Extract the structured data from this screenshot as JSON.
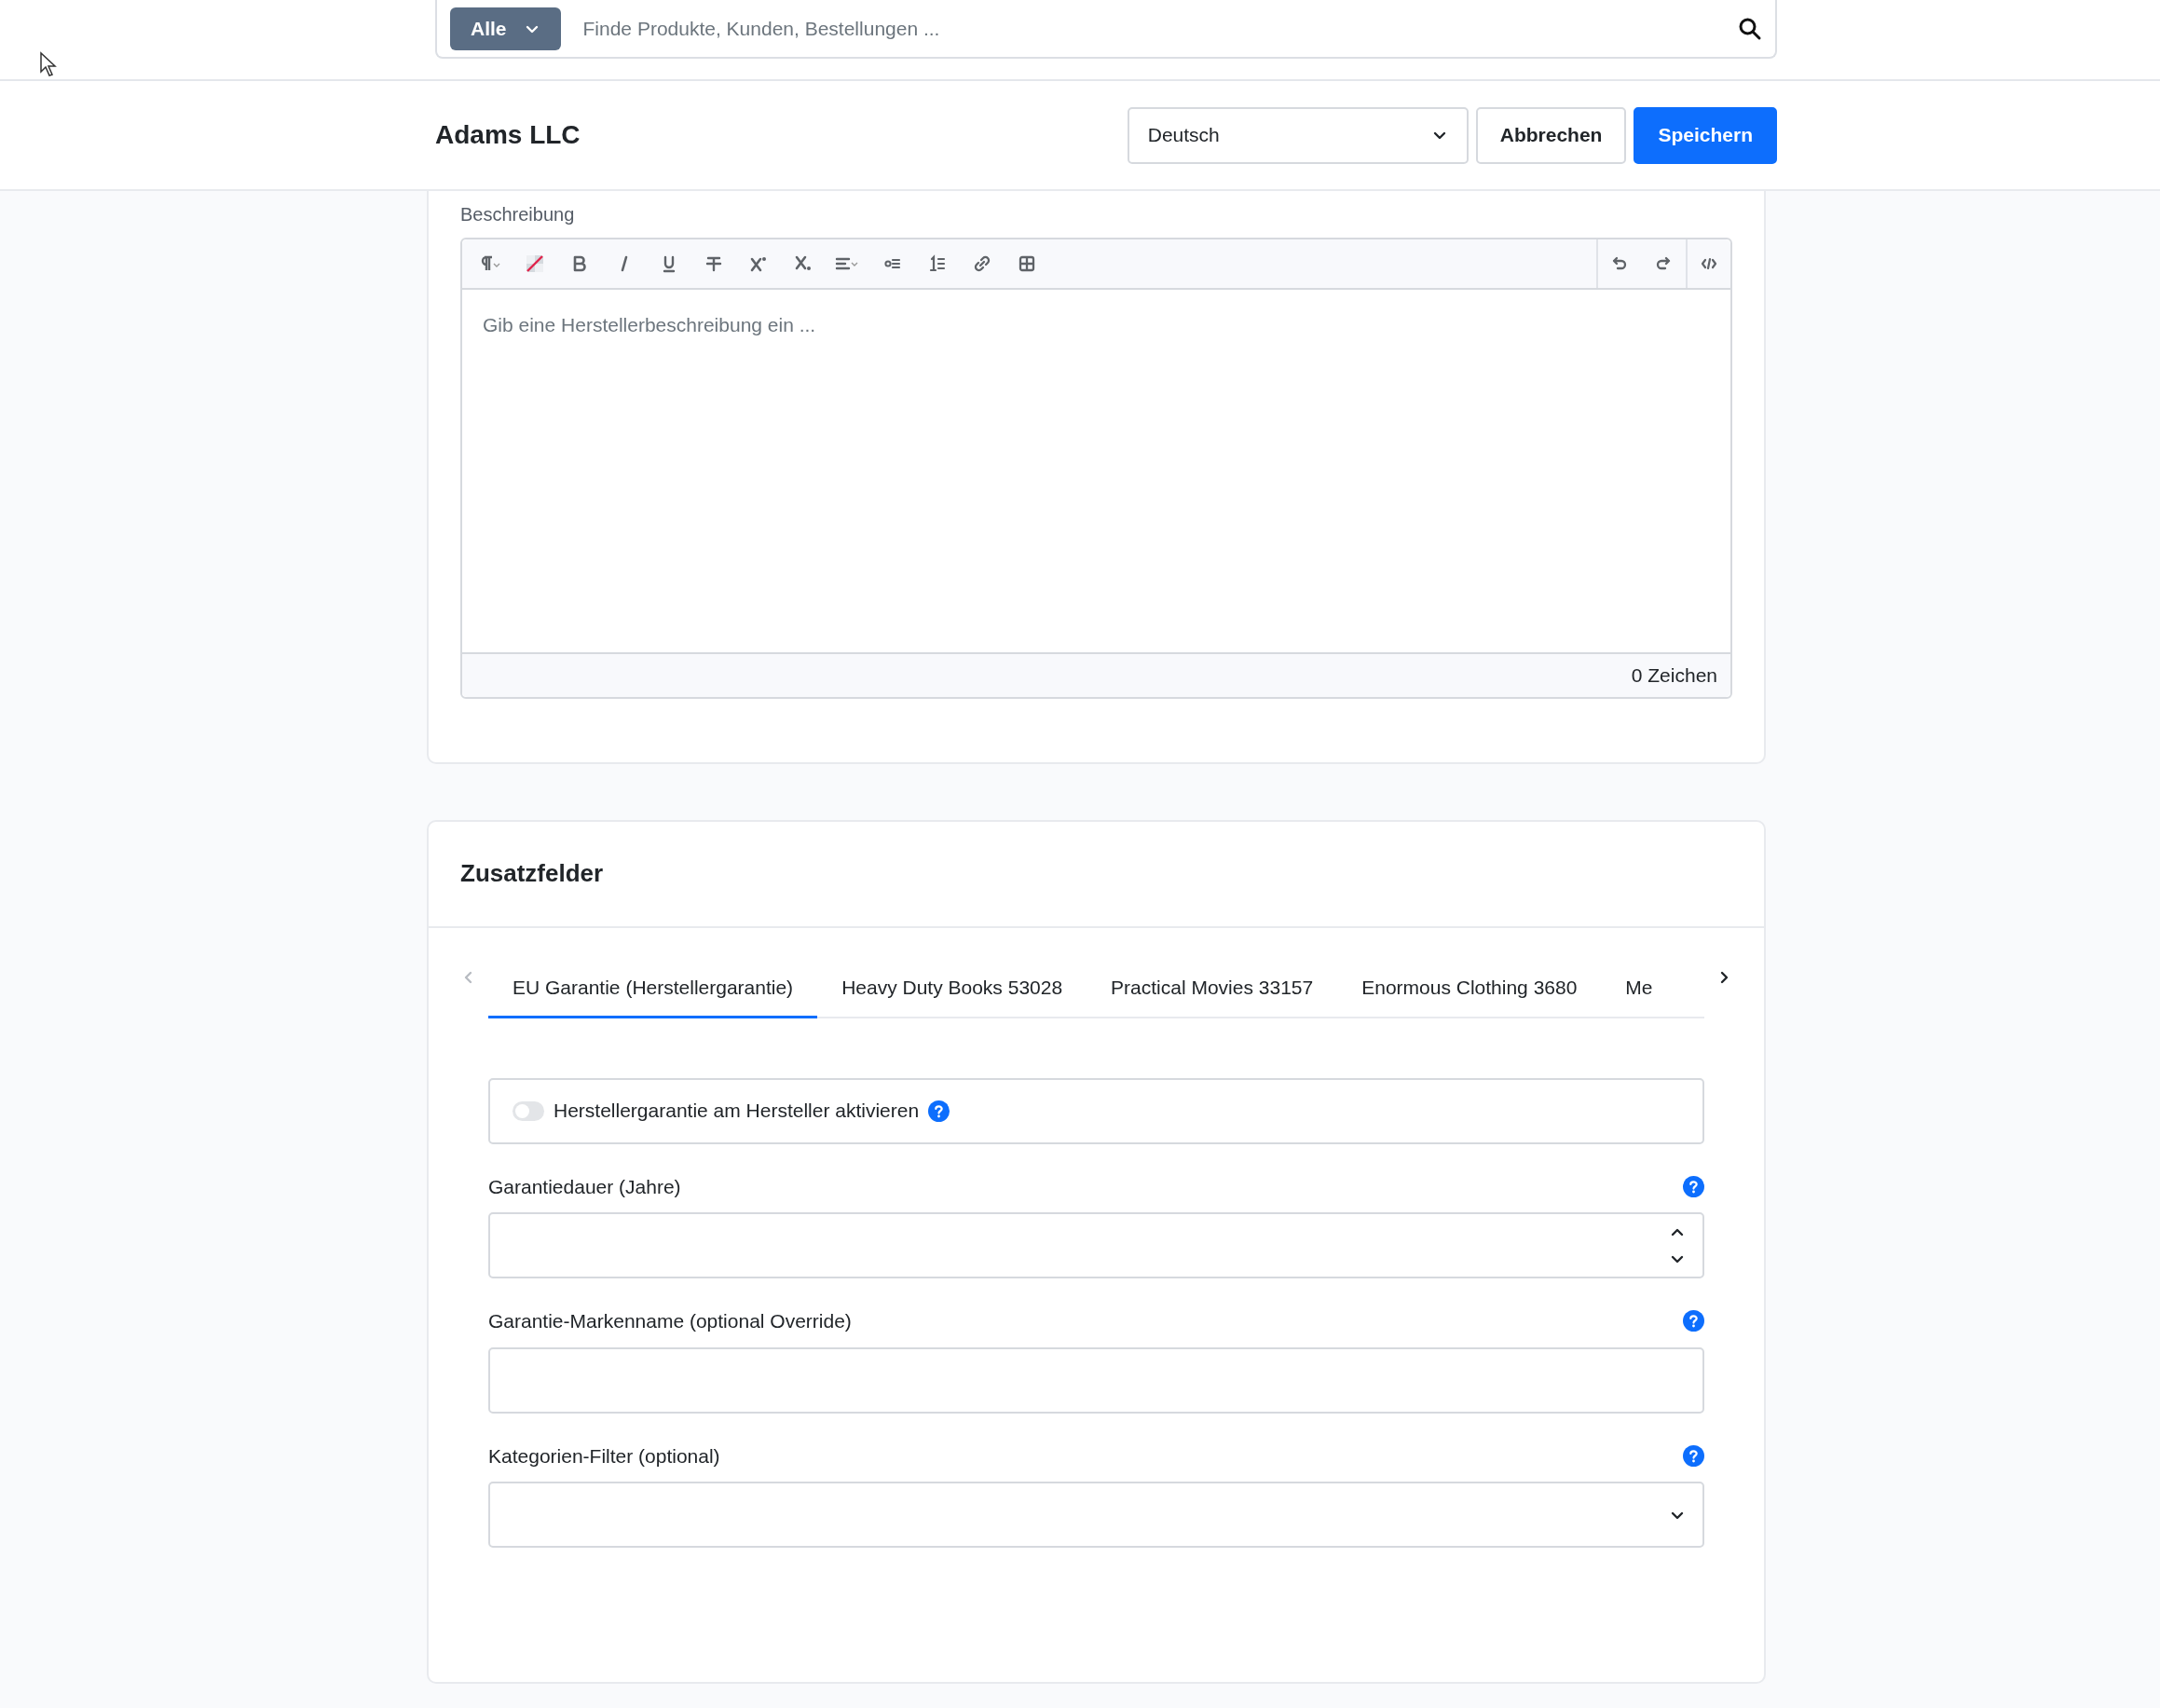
{
  "search": {
    "scope": "Alle",
    "placeholder": "Finde Produkte, Kunden, Bestellungen ..."
  },
  "header": {
    "title": "Adams LLC",
    "language": "Deutsch",
    "buttons": [
      {
        "label": "Abbrechen",
        "kind": "secondary"
      },
      {
        "label": "Speichern",
        "kind": "primary"
      }
    ]
  },
  "description": {
    "label": "Beschreibung",
    "placeholder": "Gib eine Herstellerbeschreibung ein ...",
    "counter": "0 Zeichen"
  },
  "extra_fields": {
    "title": "Zusatzfelder",
    "tab_scroll": {
      "previous_disabled": true,
      "next_disabled": false
    },
    "tabs": [
      {
        "label": "EU Garantie (Herstellergarantie)",
        "selected": true
      },
      {
        "label": "Heavy Duty Books 53028",
        "selected": false
      },
      {
        "label": "Practical Movies 33157",
        "selected": false
      },
      {
        "label": "Enormous Clothing 3680",
        "selected": false
      },
      {
        "label": "Me",
        "selected": false
      }
    ],
    "toggle": {
      "label": "Herstellergarantie am Hersteller aktivieren",
      "on": false
    },
    "fields": [
      {
        "label": "Garantiedauer (Jahre)",
        "kind": "number"
      },
      {
        "label": "Garantie-Markenname (optional Override)",
        "kind": "text"
      },
      {
        "label": "Kategorien-Filter (optional)",
        "kind": "select"
      }
    ]
  }
}
